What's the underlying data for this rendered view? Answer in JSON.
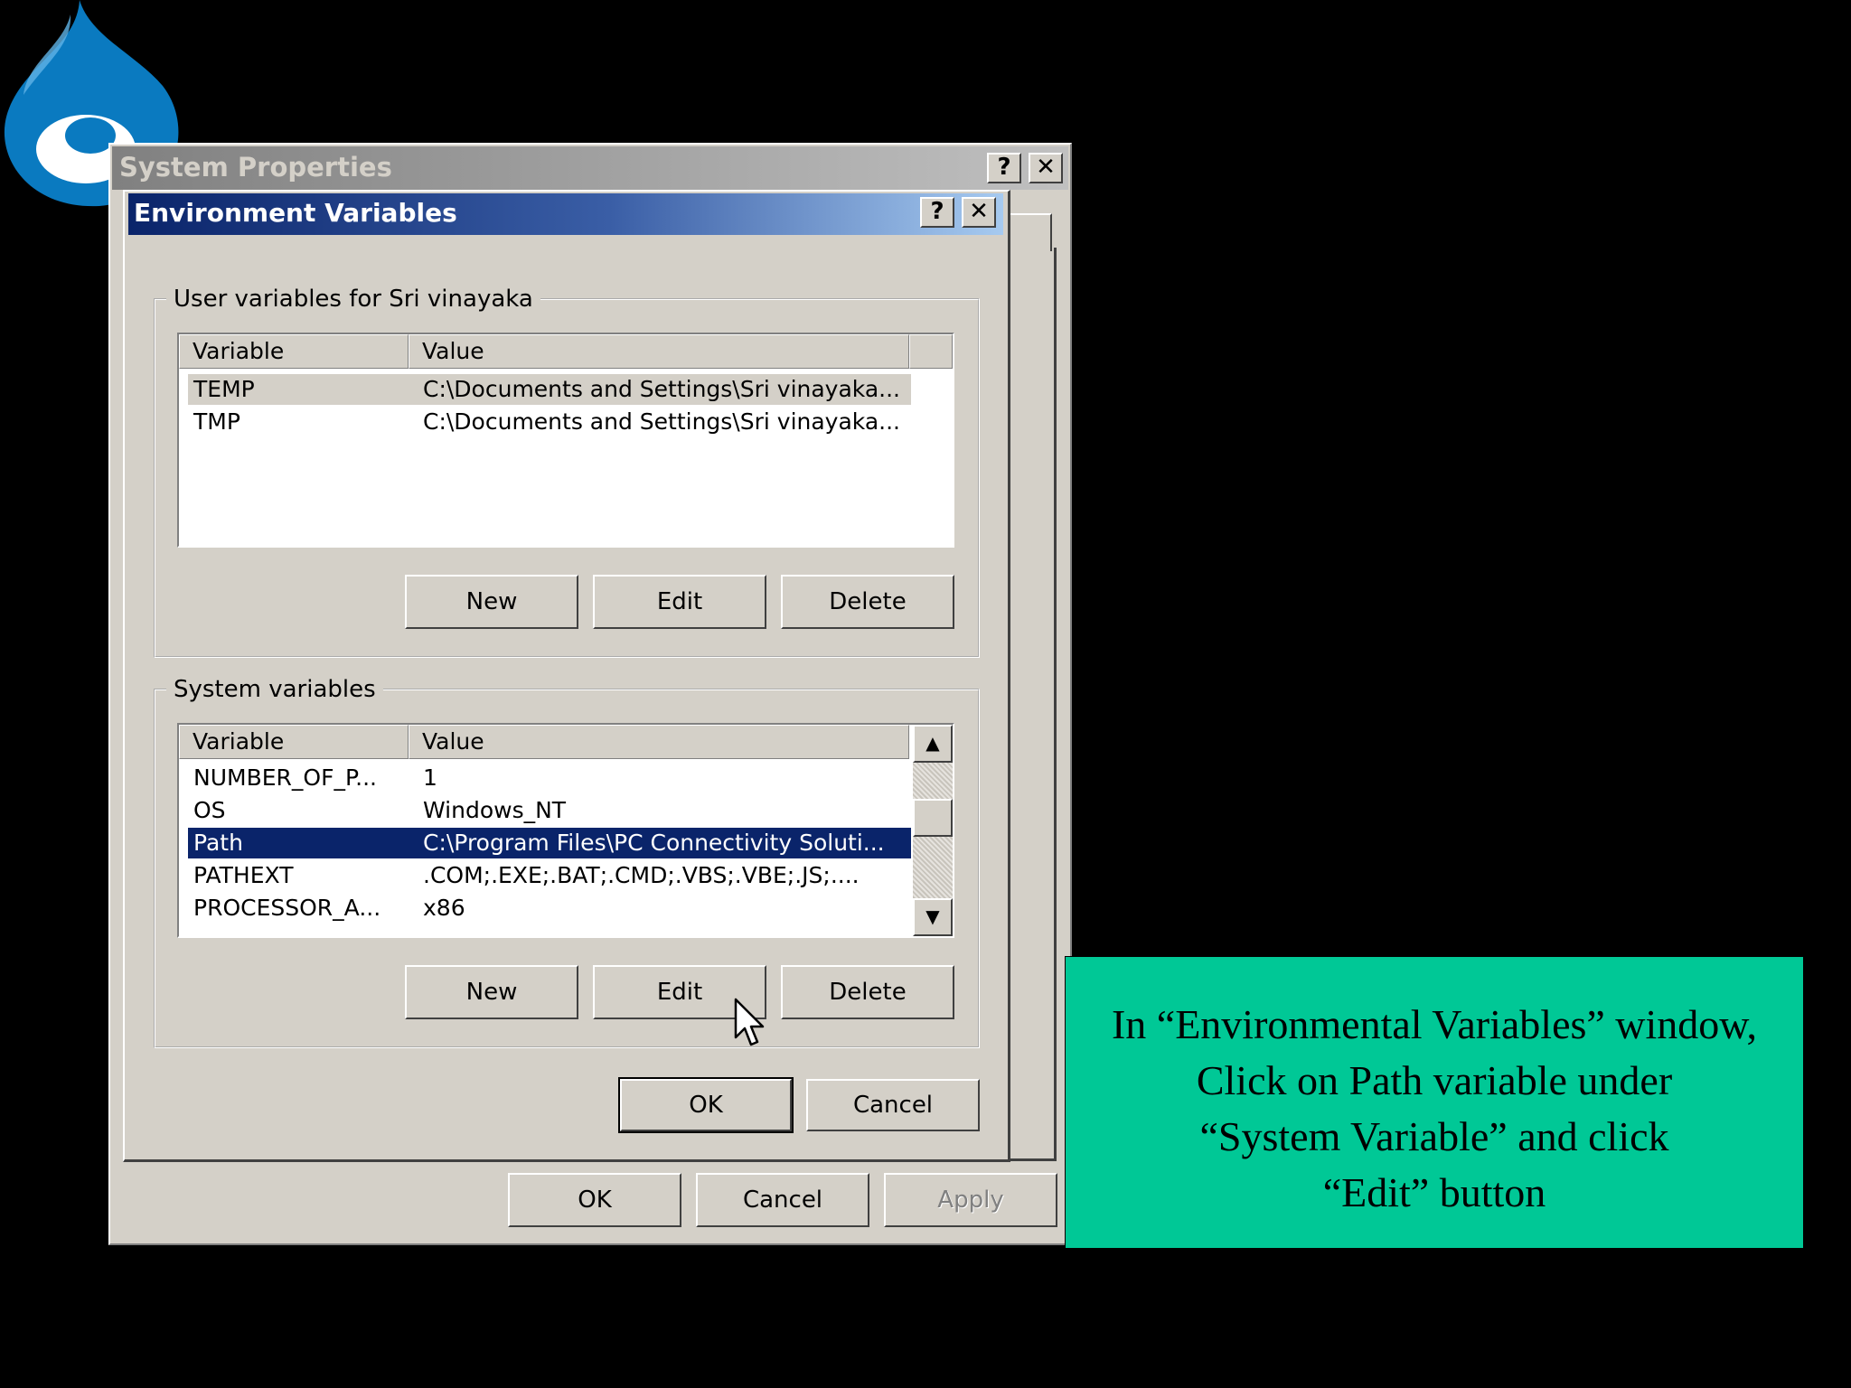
{
  "system_properties": {
    "title": "System Properties",
    "help_label": "?",
    "close_label": "✕",
    "ok_label": "OK",
    "cancel_label": "Cancel",
    "apply_label": "Apply"
  },
  "env_dialog": {
    "title": "Environment Variables",
    "help_label": "?",
    "close_label": "✕",
    "user_group": {
      "label": "User variables for Sri vinayaka",
      "columns": [
        "Variable",
        "Value"
      ],
      "rows": [
        {
          "variable": "TEMP",
          "value": "C:\\Documents and Settings\\Sri vinayaka..."
        },
        {
          "variable": "TMP",
          "value": "C:\\Documents and Settings\\Sri vinayaka..."
        }
      ],
      "new_label": "New",
      "edit_label": "Edit",
      "delete_label": "Delete"
    },
    "system_group": {
      "label": "System variables",
      "columns": [
        "Variable",
        "Value"
      ],
      "rows": [
        {
          "variable": "NUMBER_OF_P...",
          "value": "1"
        },
        {
          "variable": "OS",
          "value": "Windows_NT"
        },
        {
          "variable": "Path",
          "value": "C:\\Program Files\\PC Connectivity Soluti..."
        },
        {
          "variable": "PATHEXT",
          "value": ".COM;.EXE;.BAT;.CMD;.VBS;.VBE;.JS;...."
        },
        {
          "variable": "PROCESSOR_A...",
          "value": "x86"
        }
      ],
      "selected_row": "Path",
      "new_label": "New",
      "edit_label": "Edit",
      "delete_label": "Delete"
    },
    "ok_label": "OK",
    "cancel_label": "Cancel"
  },
  "callout": {
    "lines": [
      "In “Environmental Variables” window,",
      "Click on Path variable under",
      "“System Variable” and click",
      "“Edit” button"
    ]
  },
  "colors": {
    "callout_bg": "#00c896",
    "selection_bg": "#0a246a",
    "logo_blue": "#0077c0"
  },
  "icons": {
    "logo": "drupal-drop-logo",
    "cursor": "mouse-pointer-icon"
  }
}
